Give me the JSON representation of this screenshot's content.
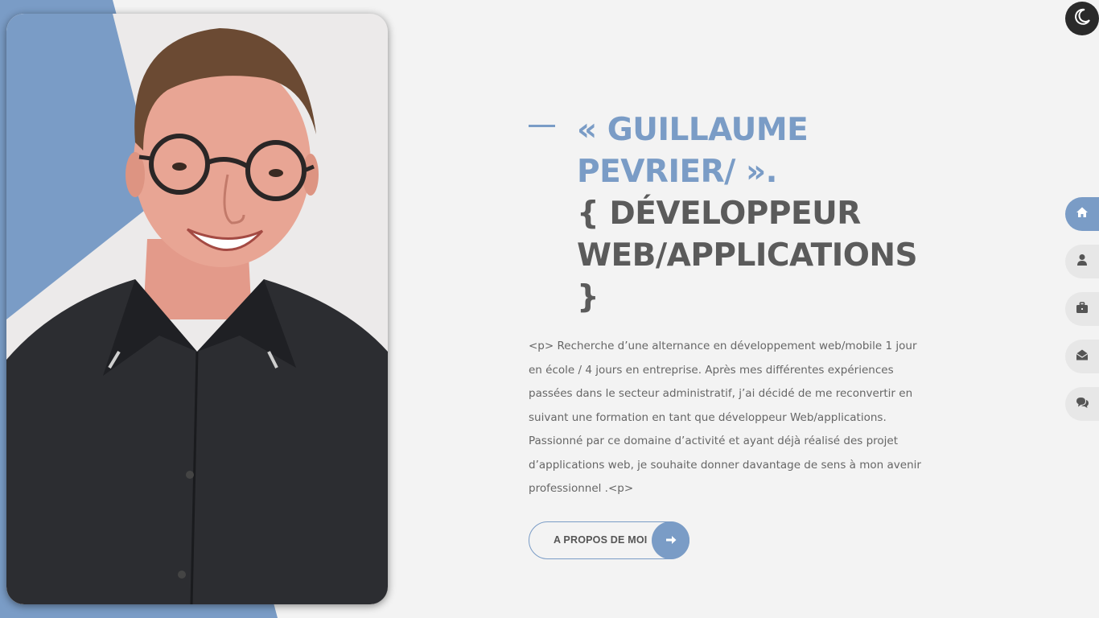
{
  "hero": {
    "name_line1": "« GUILLAUME",
    "name_line2": "PEVRIER/ ».",
    "role_line1": "{ DÉVELOPPEUR",
    "role_line2": "WEB/APPLICATIONS",
    "role_line3": "}",
    "intro": "<p> Recherche d’une alternance en développement web/mobile 1 jour en école / 4 jours en entreprise. Après mes différentes expériences passées dans le secteur administratif, j’ai décidé de me reconvertir en suivant une formation en tant que développeur Web/applications. Passionné par ce domaine d’activité et ayant déjà réalisé des projet d’applications web, je souhaite donner davantage de sens à mon avenir professionnel .<p>",
    "about_button": "A PROPOS DE MOI"
  },
  "nav": {
    "items": [
      {
        "icon": "home-icon",
        "active": true
      },
      {
        "icon": "user-icon",
        "active": false
      },
      {
        "icon": "briefcase-icon",
        "active": false
      },
      {
        "icon": "envelope-open-icon",
        "active": false
      },
      {
        "icon": "comments-icon",
        "active": false
      }
    ]
  },
  "theme": {
    "icon": "moon-icon"
  },
  "colors": {
    "accent": "#7a9cc6",
    "background": "#f3f3f3",
    "heading": "#5b5b5b",
    "text": "#666666"
  }
}
